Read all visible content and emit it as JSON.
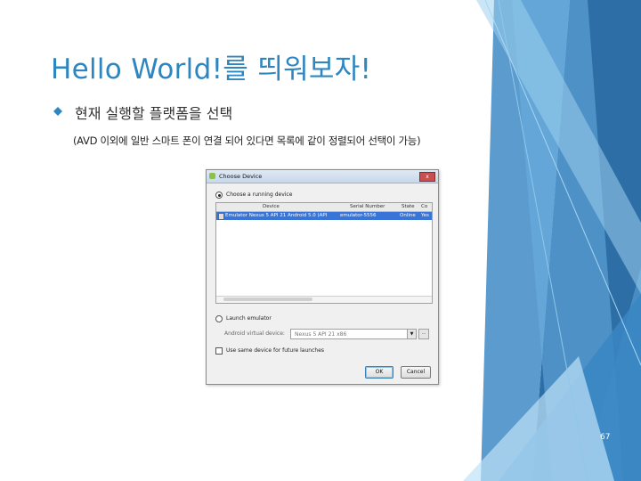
{
  "slide": {
    "title": "Hello World!를 띄워보자!",
    "bullet": "현재 실행할 플랫폼을 선택",
    "subtext": "(AVD 이외에 일반 스마트 폰이 연결 되어 있다면 목록에 같이 정렬되어 선택이 가능)",
    "page_number": "67",
    "accent_color": "#2e86c1"
  },
  "dialog": {
    "title": "Choose Device",
    "close_label": "x",
    "running_option_label": "Choose a running device",
    "table": {
      "headers": [
        "Device",
        "Serial Number",
        "State",
        "Co"
      ],
      "rows": [
        [
          "Emulator Nexus 5 API 21 Android 5.0 (API",
          "emulator-5556",
          "Online",
          "Yes"
        ]
      ]
    },
    "launch_option_label": "Launch emulator",
    "avd_label": "Android virtual device:",
    "avd_value": "Nexus 5 API 21 x86",
    "avd_more": "...",
    "avd_arrow": "▼",
    "same_device_label": "Use same device for future launches",
    "ok_label": "OK",
    "cancel_label": "Cancel"
  }
}
